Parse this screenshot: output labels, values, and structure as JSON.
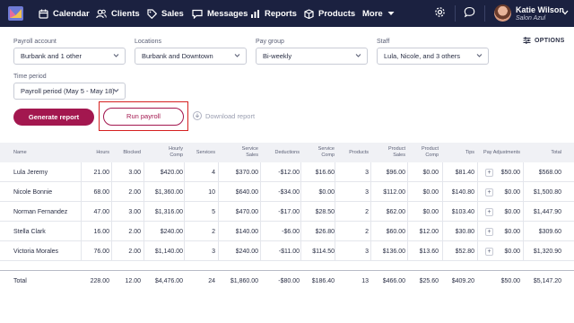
{
  "nav": {
    "items": [
      {
        "label": "Calendar",
        "icon": "calendar-icon"
      },
      {
        "label": "Clients",
        "icon": "clients-icon"
      },
      {
        "label": "Sales",
        "icon": "tag-icon"
      },
      {
        "label": "Messages",
        "icon": "messages-icon"
      },
      {
        "label": "Reports",
        "icon": "bar-chart-icon"
      },
      {
        "label": "Products",
        "icon": "box-icon"
      },
      {
        "label": "More",
        "icon": "caret-down-icon"
      }
    ],
    "user_name": "Katie Wilson",
    "salon": "Salon Azul"
  },
  "filters": {
    "payroll_account": {
      "label": "Payroll account",
      "value": "Burbank and 1 other"
    },
    "locations": {
      "label": "Locations",
      "value": "Burbank and Downtown"
    },
    "pay_group": {
      "label": "Pay group",
      "value": "Bi-weekly"
    },
    "staff": {
      "label": "Staff",
      "value": "Lula, Nicole, and 3 others"
    },
    "time_period": {
      "label": "Time period",
      "value": "Payroll period (May 5 - May 18)"
    },
    "options_label": "OPTIONS"
  },
  "actions": {
    "generate": "Generate report",
    "run": "Run payroll",
    "download": "Download report"
  },
  "table": {
    "headers": [
      "Name",
      "Hours",
      "Blocked",
      "Hourly Comp",
      "Services",
      "Service Sales",
      "Deductions",
      "Service Comp",
      "Products",
      "Product Sales",
      "Product Comp",
      "Tips",
      "Pay Adjustments",
      "Total"
    ],
    "rows": [
      [
        "Lula Jeremy",
        "21.00",
        "3.00",
        "$420.00",
        "4",
        "$370.00",
        "-$12.00",
        "$16.60",
        "3",
        "$96.00",
        "$0.00",
        "$81.40",
        "$50.00",
        "$568.00"
      ],
      [
        "Nicole Bonnie",
        "68.00",
        "2.00",
        "$1,360.00",
        "10",
        "$640.00",
        "-$34.00",
        "$0.00",
        "3",
        "$112.00",
        "$0.00",
        "$140.80",
        "$0.00",
        "$1,500.80"
      ],
      [
        "Norman Fernandez",
        "47.00",
        "3.00",
        "$1,316.00",
        "5",
        "$470.00",
        "-$17.00",
        "$28.50",
        "2",
        "$62.00",
        "$0.00",
        "$103.40",
        "$0.00",
        "$1,447.90"
      ],
      [
        "Stella Clark",
        "16.00",
        "2.00",
        "$240.00",
        "2",
        "$140.00",
        "-$6.00",
        "$26.80",
        "2",
        "$60.00",
        "$12.00",
        "$30.80",
        "$0.00",
        "$309.60"
      ],
      [
        "Victoria Morales",
        "76.00",
        "2.00",
        "$1,140.00",
        "3",
        "$240.00",
        "-$11.00",
        "$114.50",
        "3",
        "$136.00",
        "$13.60",
        "$52.80",
        "$0.00",
        "$1,320.90"
      ]
    ],
    "total": [
      "Total",
      "228.00",
      "12.00",
      "$4,476.00",
      "24",
      "$1,860.00",
      "-$80.00",
      "$186.40",
      "13",
      "$466.00",
      "$25.60",
      "$409.20",
      "$50.00",
      "$5,147.20"
    ]
  },
  "colors": {
    "nav_bg": "#1b2140",
    "accent": "#a3174f",
    "highlight": "#d62020"
  }
}
